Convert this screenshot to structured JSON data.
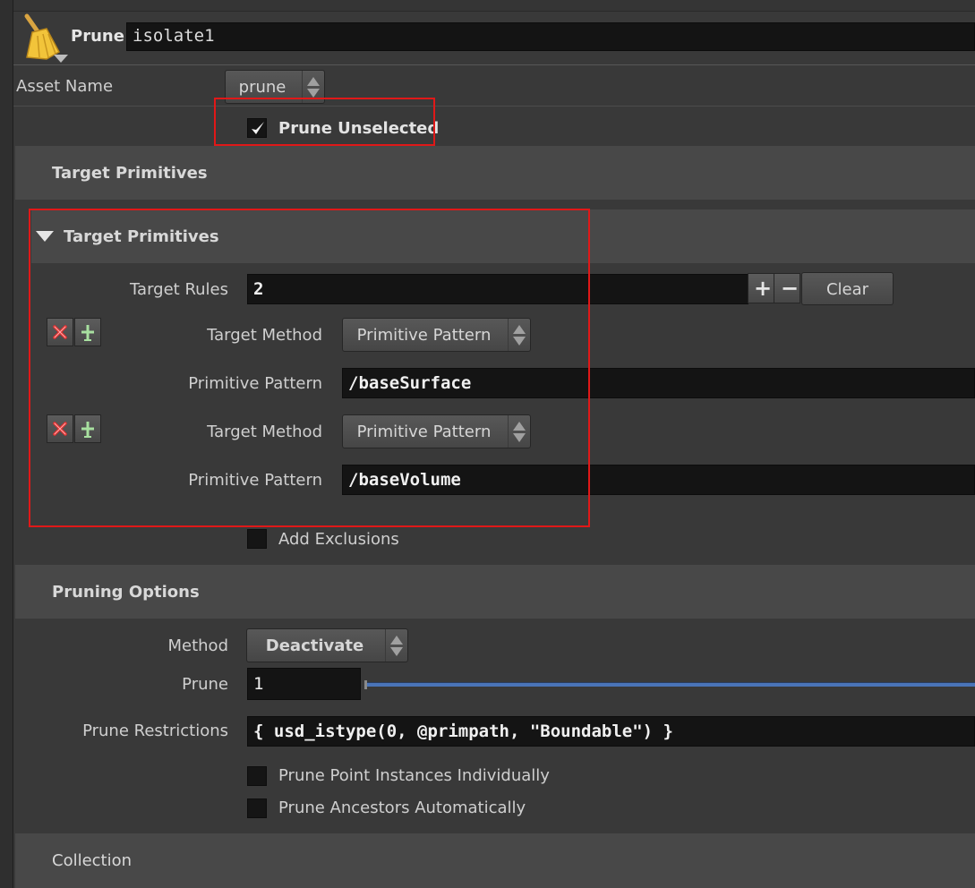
{
  "node": {
    "type_label": "Prune",
    "name_value": "isolate1"
  },
  "asset_name": {
    "label": "Asset Name",
    "value": "prune"
  },
  "prune_unselected": {
    "label": "Prune Unselected",
    "checked": true
  },
  "target_primitives": {
    "section_title": "Target Primitives",
    "folder_title": "Target Primitives",
    "rules_label": "Target Rules",
    "rules_count": "2",
    "add_label": "+",
    "remove_label": "−",
    "clear_label": "Clear",
    "rules": [
      {
        "method_label": "Target Method",
        "method_value": "Primitive Pattern",
        "pattern_label": "Primitive Pattern",
        "pattern_value": "/baseSurface"
      },
      {
        "method_label": "Target Method",
        "method_value": "Primitive Pattern",
        "pattern_label": "Primitive Pattern",
        "pattern_value": "/baseVolume"
      }
    ]
  },
  "add_exclusions": {
    "label": "Add Exclusions",
    "checked": false
  },
  "pruning_options": {
    "section_title": "Pruning Options",
    "method_label": "Method",
    "method_value": "Deactivate",
    "prune_label": "Prune",
    "prune_value": "1",
    "restrictions_label": "Prune Restrictions",
    "restrictions_value": "{ usd_istype(0, @primpath, \"Boundable\") }",
    "point_instances_label": "Prune Point Instances Individually",
    "ancestors_label": "Prune Ancestors Automatically"
  },
  "collection": {
    "section_title": "Collection"
  },
  "colors": {
    "highlight": "#e01818",
    "background": "#393939",
    "field": "#141414"
  }
}
